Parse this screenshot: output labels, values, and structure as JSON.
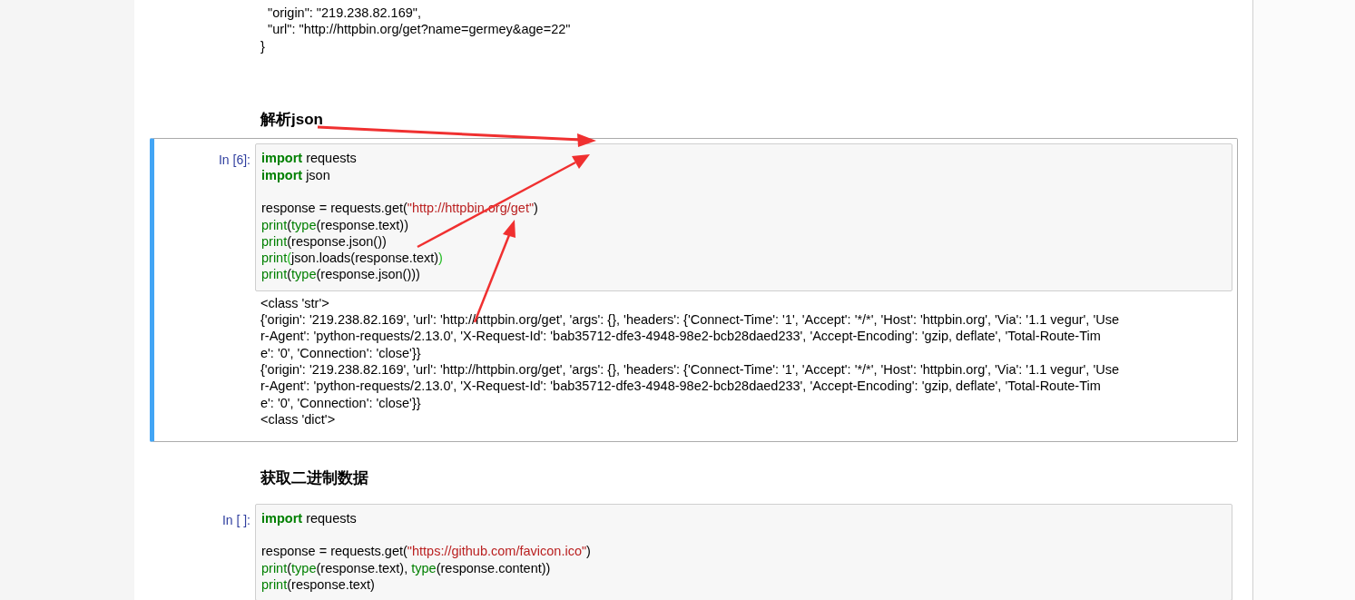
{
  "output_above": [
    "  \"origin\": \"219.238.82.169\",",
    "  \"url\": \"http://httpbin.org/get?name=germey&age=22\"",
    "}"
  ],
  "sections": [
    {
      "heading": "解析json",
      "cell": {
        "prompt": "In [6]:",
        "selected": true,
        "code": [
          {
            "tokens": [
              {
                "text": "import",
                "kind": "keyword"
              },
              {
                "text": " requests",
                "kind": "plain"
              }
            ]
          },
          {
            "tokens": [
              {
                "text": "import",
                "kind": "keyword"
              },
              {
                "text": " json",
                "kind": "plain"
              }
            ]
          },
          {
            "blank_before": true,
            "tokens": [
              {
                "text": "response = requests.get(",
                "kind": "plain"
              },
              {
                "text": "\"http://httpbin.org/get\"",
                "kind": "string"
              },
              {
                "text": ")",
                "kind": "plain"
              }
            ]
          },
          {
            "tokens": [
              {
                "text": "print",
                "kind": "builtin"
              },
              {
                "text": "(",
                "kind": "plain"
              },
              {
                "text": "type",
                "kind": "builtin"
              },
              {
                "text": "(response.text))",
                "kind": "plain"
              }
            ]
          },
          {
            "tokens": [
              {
                "text": "print",
                "kind": "builtin"
              },
              {
                "text": "(response.json())",
                "kind": "plain"
              }
            ]
          },
          {
            "tokens": [
              {
                "text": "print",
                "kind": "builtin"
              },
              {
                "text": "(",
                "kind": "match"
              },
              {
                "text": "json.loads(response.text)",
                "kind": "plain"
              },
              {
                "text": ")",
                "kind": "match"
              }
            ]
          },
          {
            "tokens": [
              {
                "text": "print",
                "kind": "builtin"
              },
              {
                "text": "(",
                "kind": "plain"
              },
              {
                "text": "type",
                "kind": "builtin"
              },
              {
                "text": "(response.json()))",
                "kind": "plain"
              }
            ]
          }
        ],
        "output": [
          "<class 'str'>",
          "{'origin': '219.238.82.169', 'url': 'http://httpbin.org/get', 'args': {}, 'headers': {'Connect-Time': '1', 'Accept': '*/*', 'Host': 'httpbin.org', 'Via': '1.1 vegur', 'Use",
          "r-Agent': 'python-requests/2.13.0', 'X-Request-Id': 'bab35712-dfe3-4948-98e2-bcb28daed233', 'Accept-Encoding': 'gzip, deflate', 'Total-Route-Tim",
          "e': '0', 'Connection': 'close'}}",
          "{'origin': '219.238.82.169', 'url': 'http://httpbin.org/get', 'args': {}, 'headers': {'Connect-Time': '1', 'Accept': '*/*', 'Host': 'httpbin.org', 'Via': '1.1 vegur', 'Use",
          "r-Agent': 'python-requests/2.13.0', 'X-Request-Id': 'bab35712-dfe3-4948-98e2-bcb28daed233', 'Accept-Encoding': 'gzip, deflate', 'Total-Route-Tim",
          "e': '0', 'Connection': 'close'}}",
          "<class 'dict'>"
        ]
      }
    },
    {
      "heading": "获取二进制数据",
      "cell": {
        "prompt": "In [ ]:",
        "selected": false,
        "code": [
          {
            "tokens": [
              {
                "text": "import",
                "kind": "keyword"
              },
              {
                "text": " requests",
                "kind": "plain"
              }
            ]
          },
          {
            "blank_before": true,
            "tokens": [
              {
                "text": "response = requests.get(",
                "kind": "plain"
              },
              {
                "text": "\"https://github.com/favicon.ico\"",
                "kind": "string"
              },
              {
                "text": ")",
                "kind": "plain"
              }
            ]
          },
          {
            "tokens": [
              {
                "text": "print",
                "kind": "builtin"
              },
              {
                "text": "(",
                "kind": "plain"
              },
              {
                "text": "type",
                "kind": "builtin"
              },
              {
                "text": "(response.text), ",
                "kind": "plain"
              },
              {
                "text": "type",
                "kind": "builtin"
              },
              {
                "text": "(response.content))",
                "kind": "plain"
              }
            ]
          },
          {
            "tokens": [
              {
                "text": "print",
                "kind": "builtin"
              },
              {
                "text": "(response.text)",
                "kind": "plain"
              }
            ]
          }
        ]
      }
    }
  ]
}
